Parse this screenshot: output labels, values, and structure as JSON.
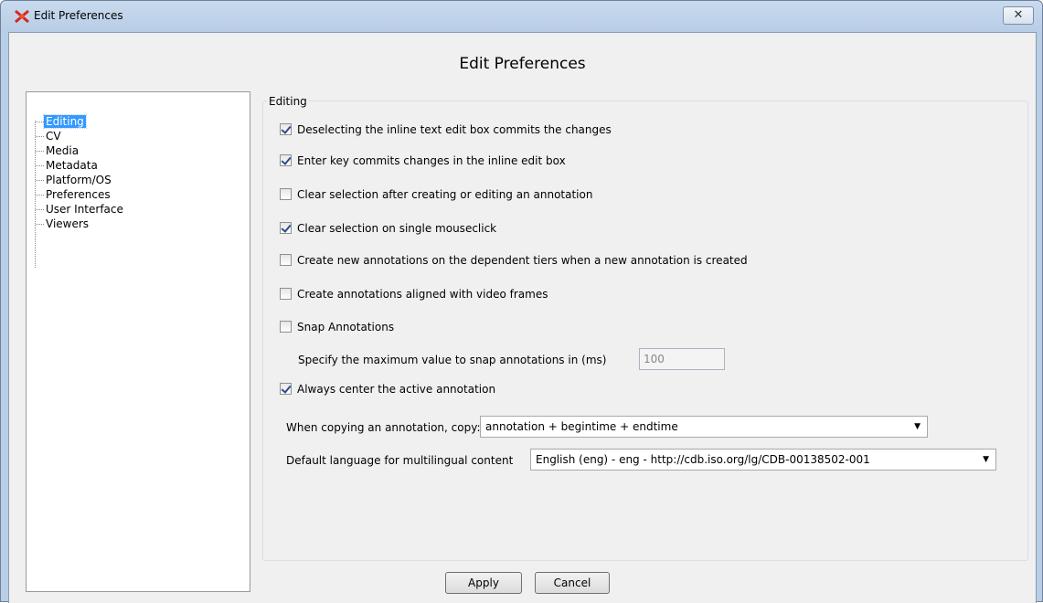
{
  "window": {
    "title": "Edit Preferences",
    "close_glyph": "✕"
  },
  "header": {
    "title": "Edit Preferences"
  },
  "tree": {
    "items": [
      {
        "label": "Editing",
        "selected": true
      },
      {
        "label": "CV",
        "selected": false
      },
      {
        "label": "Media",
        "selected": false
      },
      {
        "label": "Metadata",
        "selected": false
      },
      {
        "label": "Platform/OS",
        "selected": false
      },
      {
        "label": "Preferences",
        "selected": false
      },
      {
        "label": "User Interface",
        "selected": false
      },
      {
        "label": "Viewers",
        "selected": false
      }
    ]
  },
  "editing": {
    "group_title": "Editing",
    "options": [
      {
        "label": "Deselecting the inline text edit box commits the changes",
        "checked": true
      },
      {
        "label": "Enter key commits changes in the inline edit box",
        "checked": true
      },
      {
        "label": "Clear selection after creating or editing an annotation",
        "checked": false
      },
      {
        "label": "Clear selection on single mouseclick",
        "checked": true
      },
      {
        "label": "Create new annotations on the dependent tiers when a new annotation is created",
        "checked": false
      },
      {
        "label": "Create annotations aligned with video frames",
        "checked": false
      },
      {
        "label": "Snap Annotations",
        "checked": false
      }
    ],
    "snap_label": "Specify the maximum value to snap annotations in (ms)",
    "snap_value": "100",
    "center_option": {
      "label": "Always center the active annotation",
      "checked": true
    },
    "copy_label": "When copying an annotation, copy:",
    "copy_value": "annotation + begintime + endtime",
    "language_label": "Default language for multilingual content",
    "language_value": "English (eng) - eng - http://cdb.iso.org/lg/CDB-00138502-001",
    "dropdown_arrow": "▼"
  },
  "buttons": {
    "apply": "Apply",
    "cancel": "Cancel"
  },
  "colors": {
    "selection": "#3399ff",
    "titlebar": "#c9daee",
    "dialog_bg": "#f0f0f0"
  },
  "icons": {
    "app": "elan-logo-icon",
    "close": "close-icon",
    "checkbox_checked": "checkmark-icon",
    "dropdown": "chevron-down-icon"
  }
}
